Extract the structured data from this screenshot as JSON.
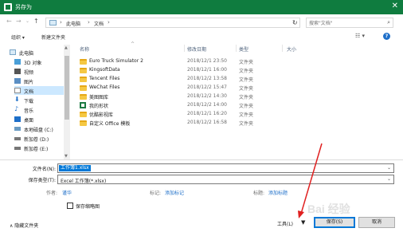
{
  "window": {
    "title": "另存为",
    "close_glyph": "✕"
  },
  "nav": {
    "back": "←",
    "forward": "→",
    "up": "↑",
    "history_drop": "⌄"
  },
  "address": {
    "path": [
      "此电脑",
      "文档"
    ],
    "separator": "›",
    "dropdown": "⌄"
  },
  "refresh_glyph": "↻",
  "search": {
    "placeholder": "搜索\"文档\"",
    "icon": "search-icon"
  },
  "toolbar": {
    "organize": "组织 ▾",
    "new_folder": "新建文件夹",
    "view_glyph": "☷ ▾",
    "help_glyph": "?"
  },
  "sidebar": {
    "items": [
      {
        "label": "此电脑",
        "icon": "computer-icon"
      },
      {
        "label": "3D 对象",
        "icon": "cube-icon"
      },
      {
        "label": "视频",
        "icon": "video-icon"
      },
      {
        "label": "图片",
        "icon": "picture-icon"
      },
      {
        "label": "文档",
        "icon": "document-icon",
        "selected": true
      },
      {
        "label": "下载",
        "icon": "download-icon"
      },
      {
        "label": "音乐",
        "icon": "music-icon"
      },
      {
        "label": "桌面",
        "icon": "desktop-icon"
      },
      {
        "label": "本地磁盘 (C:)",
        "icon": "drive-icon"
      },
      {
        "label": "新加卷 (D:)",
        "icon": "drive-icon"
      },
      {
        "label": "新加卷 (E:)",
        "icon": "drive-icon"
      }
    ]
  },
  "columns": {
    "name": "名称",
    "date": "修改日期",
    "type": "类型",
    "size": "大小"
  },
  "files": [
    {
      "name": "Euro Truck Simulator 2",
      "date": "2018/12/1 23:50",
      "type": "文件夹",
      "icon": "folder-icon"
    },
    {
      "name": "KingsoftData",
      "date": "2018/12/1 16:00",
      "type": "文件夹",
      "icon": "folder-icon"
    },
    {
      "name": "Tencent Files",
      "date": "2018/12/2 13:58",
      "type": "文件夹",
      "icon": "folder-icon"
    },
    {
      "name": "WeChat Files",
      "date": "2018/12/2 15:47",
      "type": "文件夹",
      "icon": "folder-icon"
    },
    {
      "name": "美图图库",
      "date": "2018/12/2 14:30",
      "type": "文件夹",
      "icon": "folder-icon"
    },
    {
      "name": "我的形状",
      "date": "2018/12/2 14:00",
      "type": "文件夹",
      "icon": "excel-folder-icon"
    },
    {
      "name": "优酷影视库",
      "date": "2018/12/1 16:20",
      "type": "文件夹",
      "icon": "folder-icon"
    },
    {
      "name": "自定义 Office 模板",
      "date": "2018/12/2 16:58",
      "type": "文件夹",
      "icon": "folder-icon"
    }
  ],
  "form": {
    "filename_label": "文件名(N):",
    "filename_value": "工作簿1.xlsx",
    "filetype_label": "保存类型(T):",
    "filetype_value": "Excel 工作簿(*.xlsx)",
    "author_label": "作者:",
    "author_value": "谨华",
    "tags_label": "标记:",
    "tags_value": "添加标记",
    "title_label": "标题:",
    "title_value": "添加标题",
    "thumbnail_label": "保存缩略图"
  },
  "footer": {
    "hide_folders": "∧ 隐藏文件夹",
    "tools": "工具(L)",
    "tools_dropdown": "▼",
    "save": "保存(S)",
    "cancel": "取消"
  },
  "watermark": "Bai 经验",
  "colors": {
    "titlebar": "#0f7c3f",
    "selection": "#0078d7",
    "accent_arrow": "#e02020"
  }
}
